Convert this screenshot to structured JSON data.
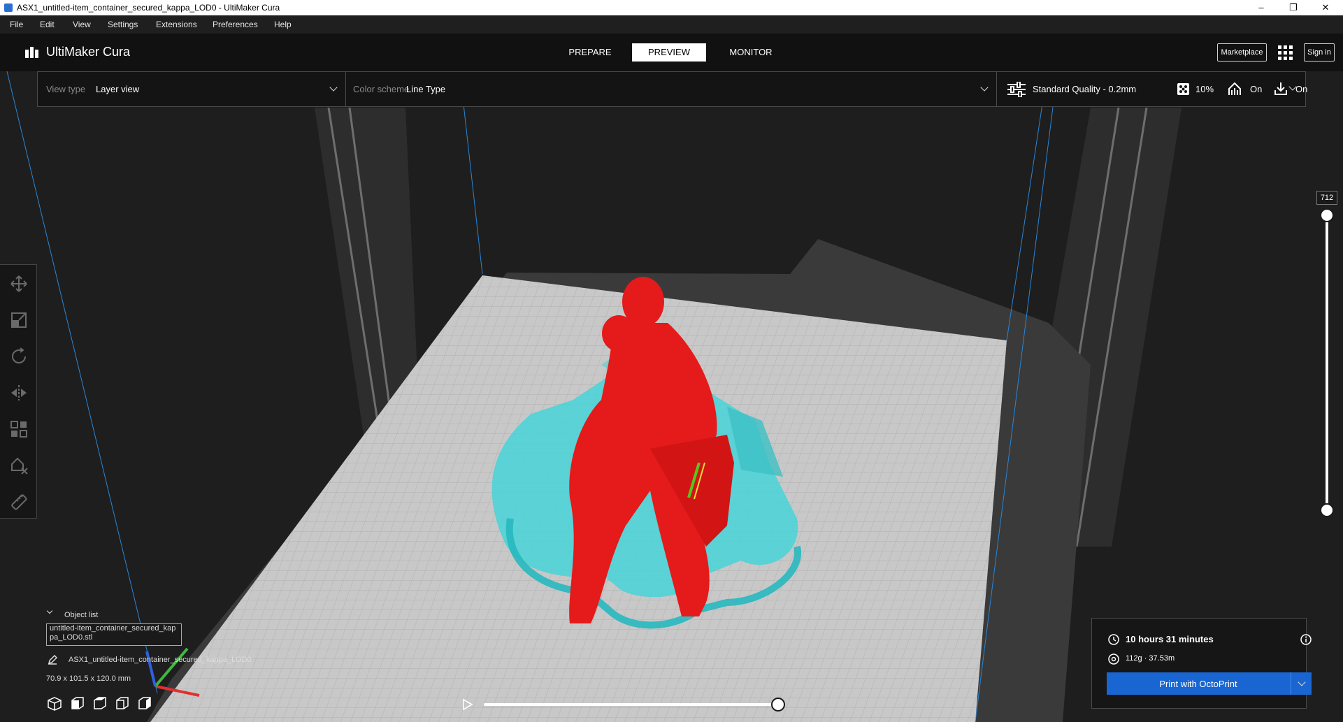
{
  "window": {
    "title": "ASX1_untitled-item_container_secured_kappa_LOD0 - UltiMaker Cura",
    "controls": {
      "minimize": "–",
      "maximize": "❐",
      "close": "✕"
    }
  },
  "menu": {
    "items": [
      {
        "label": "File"
      },
      {
        "label": "Edit"
      },
      {
        "label": "View"
      },
      {
        "label": "Settings"
      },
      {
        "label": "Extensions"
      },
      {
        "label": "Preferences"
      },
      {
        "label": "Help"
      }
    ]
  },
  "header": {
    "logo": "UltiMaker Cura",
    "stages": [
      {
        "label": "PREPARE"
      },
      {
        "label": "PREVIEW"
      },
      {
        "label": "MONITOR"
      }
    ],
    "active_stage": "PREVIEW",
    "marketplace": "Marketplace",
    "sign_in": "Sign in"
  },
  "toolbar": {
    "view_type_label": "View type",
    "view_type_value": "Layer view",
    "color_scheme_label": "Color scheme",
    "color_scheme_value": "Line Type",
    "quality": "Standard Quality - 0.2mm",
    "infill": "10%",
    "support": "On",
    "adhesion": "On"
  },
  "left_tools": [
    {
      "icon": "move-icon"
    },
    {
      "icon": "scale-icon"
    },
    {
      "icon": "rotate-icon"
    },
    {
      "icon": "mirror-icon"
    },
    {
      "icon": "per-model-settings-icon"
    },
    {
      "icon": "support-blocker-icon"
    },
    {
      "icon": "measure-icon"
    }
  ],
  "layer_slider": {
    "current_layer": "712"
  },
  "object_list": {
    "header": "Object list",
    "item": "untitled-item_container_secured_kappa_LOD0.stl",
    "object_name": "ASX1_untitled-item_container_secured_kappa_LOD0",
    "dimensions": "70.9 x 101.5 x 120.0 mm"
  },
  "print_panel": {
    "time": "10 hours 31 minutes",
    "material": "112g · 37.53m",
    "print_button": "Print with OctoPrint"
  },
  "colors": {
    "model": "#e51a1a",
    "support": "#46d4d8",
    "build_plate": "#c8c8c8",
    "accent": "#1966d2"
  }
}
